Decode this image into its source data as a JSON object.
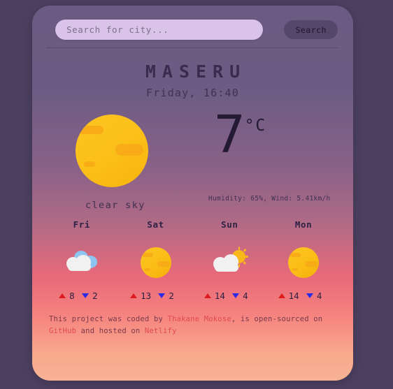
{
  "theme": {
    "page_background": "#4b4060",
    "card_gradient_top": "#6b5b82",
    "card_gradient_bottom": "#f8b294",
    "accent_high": "#e01b1b",
    "accent_low": "#2a2ae6",
    "link_color": "#e04a52",
    "search_field_background": "#d9c3e8",
    "search_button_background": "#53476a"
  },
  "search": {
    "placeholder": "Search for city...",
    "value": "",
    "button_label": "Search",
    "icon": "search-icon"
  },
  "current": {
    "city": "MASERU",
    "datetime": "Friday, 16:40",
    "icon": "sun-icon",
    "condition": "clear sky",
    "temperature": "7",
    "unit": "°C",
    "details": "Humidity: 65%, Wind: 5.41km/h"
  },
  "forecast": [
    {
      "day": "Fri",
      "icon": "cloud-icon",
      "high": "8",
      "low": "2"
    },
    {
      "day": "Sat",
      "icon": "sun-icon",
      "high": "13",
      "low": "2"
    },
    {
      "day": "Sun",
      "icon": "sun-cloud-icon",
      "high": "14",
      "low": "4"
    },
    {
      "day": "Mon",
      "icon": "sun-icon",
      "high": "14",
      "low": "4"
    }
  ],
  "footer": {
    "part1": "This project was coded by ",
    "author": "Thakane Mokose",
    "part2": ", is open-sourced on ",
    "source_link": "GitHub",
    "part3": " and hosted on ",
    "host_link": "Netlify"
  }
}
